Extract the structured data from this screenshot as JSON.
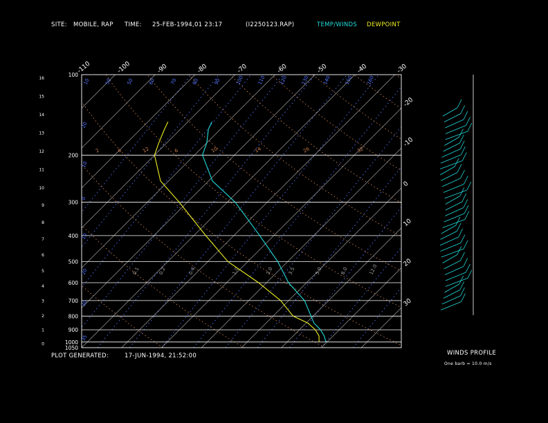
{
  "header": {
    "site_label": "SITE:",
    "site_value": "MOBILE, RAP",
    "time_label": "TIME:",
    "time_value": "25-FEB-1994,01 23:17",
    "file_value": "(I2250123.RAP)",
    "temp_winds_label": "TEMP/WINDS",
    "dewpoint_label": "DEWPOINT"
  },
  "footer": {
    "generated_label": "PLOT GENERATED:",
    "generated_value": "17-JUN-1994, 21:52:00",
    "winds_profile_label": "WINDS PROFILE",
    "barb_note": "One barb = 10.0 m/s"
  },
  "colors": {
    "background": "#000000",
    "frame": "#ffffff",
    "isotherm": "#a0a0a0",
    "mixing_ratio": "#5577ff",
    "dry_adiabat": "#d08050",
    "temperature": "#22dddd",
    "dewpoint": "#eeee22",
    "header_temp": "#22dddd",
    "header_dew": "#eeee22"
  },
  "chart_data": {
    "type": "skew-t",
    "pressure_labels": [
      "100",
      "200",
      "300",
      "400",
      "500",
      "600",
      "700",
      "800",
      "900",
      "1000",
      "1050"
    ],
    "pressure_levels_hpa": [
      100,
      200,
      300,
      400,
      500,
      600,
      700,
      800,
      900,
      1000,
      1050
    ],
    "height_labels_km": [
      "16",
      "15",
      "14",
      "13",
      "12",
      "11",
      "10",
      "9",
      "8",
      "7",
      "6",
      "5",
      "4",
      "3",
      "2",
      "1",
      "0"
    ],
    "isotherm_labels_c": [
      "-110",
      "-100",
      "-90",
      "-80",
      "-70",
      "-60",
      "-50",
      "-40",
      "-30",
      "-20",
      "-10",
      "0",
      "10",
      "20",
      "30"
    ],
    "isotherm_values_c": [
      -110,
      -100,
      -90,
      -80,
      -70,
      -60,
      -50,
      -40,
      -30,
      -20,
      -10,
      0,
      10,
      20,
      30
    ],
    "mixing_ratio_top_labels": [
      "10",
      "50",
      "50",
      "60",
      "70",
      "80",
      "90",
      "100",
      "110",
      "120",
      "130",
      "140",
      "150",
      "160"
    ],
    "mixing_ratio_left_labels": [
      "70",
      "20",
      "10",
      "0",
      "10",
      "20",
      "30",
      "35"
    ],
    "dry_adiabat_labels": [
      "2",
      "6",
      "12",
      "6",
      "10",
      "14",
      "26",
      "32"
    ],
    "lower_mr_labels": [
      "0.1",
      "0.2",
      "0.4",
      "1.0",
      "2.0",
      "3.5",
      "5.0",
      "8.0",
      "12.0"
    ],
    "temperature_profile": [
      {
        "p": 1000,
        "t": 19.7
      },
      {
        "p": 950,
        "t": 17.8
      },
      {
        "p": 900,
        "t": 15.3
      },
      {
        "p": 850,
        "t": 12.0
      },
      {
        "p": 800,
        "t": 9.5
      },
      {
        "p": 700,
        "t": 4.0
      },
      {
        "p": 600,
        "t": -4.5
      },
      {
        "p": 500,
        "t": -12.5
      },
      {
        "p": 400,
        "t": -23.5
      },
      {
        "p": 300,
        "t": -38.0
      },
      {
        "p": 250,
        "t": -49.0
      },
      {
        "p": 200,
        "t": -58.0
      },
      {
        "p": 180,
        "t": -60.0
      },
      {
        "p": 160,
        "t": -63.0
      },
      {
        "p": 150,
        "t": -64.0
      }
    ],
    "dewpoint_profile": [
      {
        "p": 1000,
        "t": 18.0
      },
      {
        "p": 950,
        "t": 16.5
      },
      {
        "p": 900,
        "t": 14.0
      },
      {
        "p": 850,
        "t": 10.5
      },
      {
        "p": 800,
        "t": 5.0
      },
      {
        "p": 700,
        "t": -2.0
      },
      {
        "p": 600,
        "t": -12.0
      },
      {
        "p": 500,
        "t": -25.0
      },
      {
        "p": 400,
        "t": -37.0
      },
      {
        "p": 300,
        "t": -52.0
      },
      {
        "p": 250,
        "t": -62.0
      },
      {
        "p": 200,
        "t": -70.0
      },
      {
        "p": 180,
        "t": -72.0
      },
      {
        "p": 160,
        "t": -74.0
      },
      {
        "p": 150,
        "t": -75.0
      }
    ],
    "p_range_hpa": [
      100,
      1050
    ],
    "t_range_at_base_c": [
      -40,
      40
    ],
    "legend": [
      "TEMP/WINDS",
      "DEWPOINT"
    ]
  }
}
